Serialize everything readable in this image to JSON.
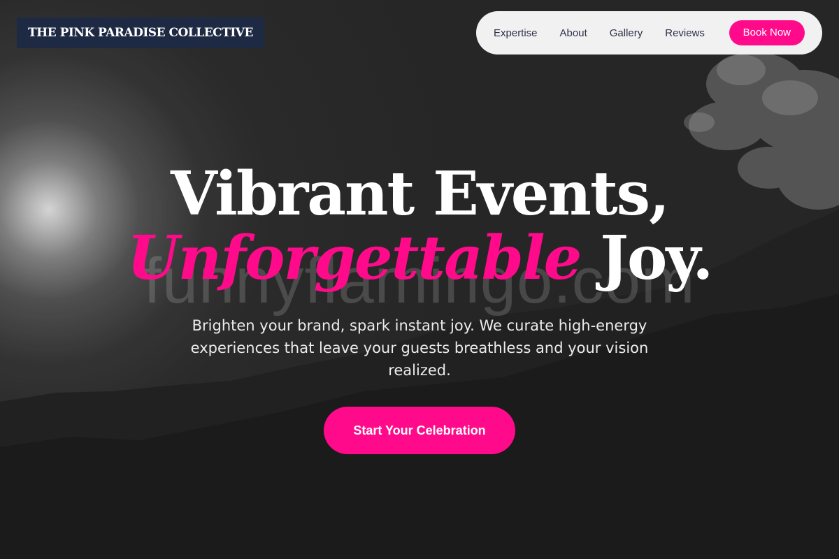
{
  "brand": {
    "name": "THE PINK PARADISE COLLECTIVE"
  },
  "nav": {
    "links": [
      {
        "label": "Expertise"
      },
      {
        "label": "About"
      },
      {
        "label": "Gallery"
      },
      {
        "label": "Reviews"
      }
    ],
    "cta_label": "Book Now"
  },
  "hero": {
    "headline_line1": "Vibrant Events,",
    "headline_accent": "Unforgettable",
    "headline_end": "Joy.",
    "subtext": "Brighten your brand, spark instant joy. We curate high-energy experiences that leave your guests breathless and your vision realized.",
    "cta_label": "Start Your Celebration",
    "watermark": "funnyflamingo.com"
  },
  "colors": {
    "accent": "#ff0a8a",
    "brand_bg": "#1e2a44",
    "nav_bg": "#f1f1f2",
    "nav_text": "#2d3345"
  }
}
